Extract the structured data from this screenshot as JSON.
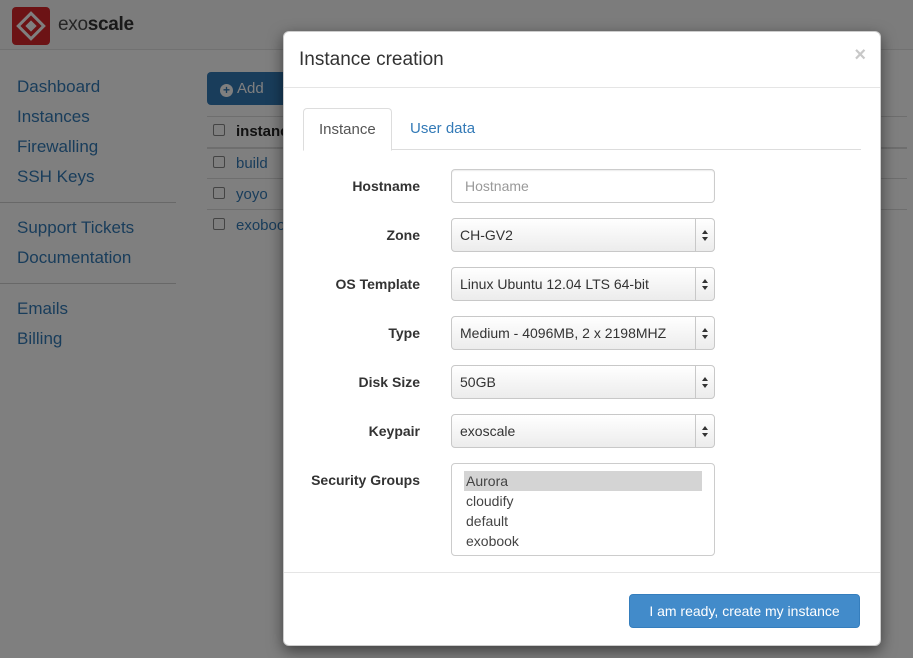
{
  "app": {
    "brand": {
      "prefix": "exo",
      "suffix": "scale"
    }
  },
  "sidebar": {
    "groups": [
      {
        "items": [
          {
            "label": "Dashboard"
          },
          {
            "label": "Instances"
          },
          {
            "label": "Firewalling"
          },
          {
            "label": "SSH Keys"
          }
        ]
      },
      {
        "items": [
          {
            "label": "Support Tickets"
          },
          {
            "label": "Documentation"
          }
        ]
      },
      {
        "items": [
          {
            "label": "Emails"
          },
          {
            "label": "Billing"
          }
        ]
      }
    ]
  },
  "main": {
    "add_button": {
      "icon": "plus-circle-icon",
      "label": "Add"
    },
    "table": {
      "header": "instanc",
      "rows": [
        {
          "name": "build"
        },
        {
          "name": "yoyo"
        },
        {
          "name": "exoboo"
        }
      ]
    }
  },
  "modal": {
    "title": "Instance creation",
    "close_label": "×",
    "tabs": [
      {
        "label": "Instance",
        "active": true
      },
      {
        "label": "User data",
        "active": false
      }
    ],
    "form": {
      "hostname": {
        "label": "Hostname",
        "placeholder": "Hostname",
        "value": ""
      },
      "zone": {
        "label": "Zone",
        "value": "CH-GV2"
      },
      "os_template": {
        "label": "OS Template",
        "value": "Linux Ubuntu 12.04 LTS 64-bit"
      },
      "type": {
        "label": "Type",
        "value": "Medium - 4096MB, 2 x 2198MHZ"
      },
      "disk_size": {
        "label": "Disk Size",
        "value": "50GB"
      },
      "keypair": {
        "label": "Keypair",
        "value": "exoscale"
      },
      "security_groups": {
        "label": "Security Groups",
        "options": [
          {
            "label": "Aurora",
            "selected": true
          },
          {
            "label": "cloudify",
            "selected": false
          },
          {
            "label": "default",
            "selected": false
          },
          {
            "label": "exobook",
            "selected": false
          }
        ]
      }
    },
    "submit_label": "I am ready, create my instance"
  },
  "colors": {
    "brand_red": "#d8262b",
    "link_blue": "#337ab7",
    "primary_button": "#428bca"
  }
}
